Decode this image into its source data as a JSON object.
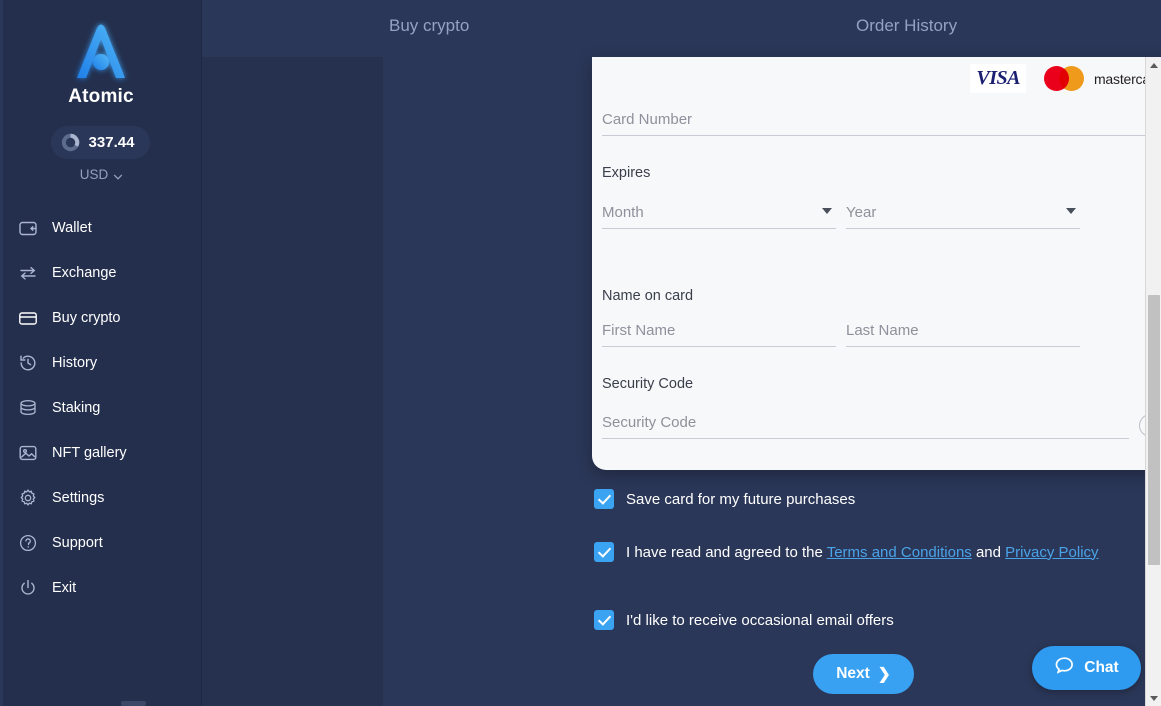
{
  "brand": {
    "name": "Atomic",
    "logo_icon": "atomic-logo-icon",
    "balance": "337.44",
    "balance_icon": "ring-chart-icon",
    "currency": "USD",
    "currency_chevron_icon": "chevron-down-icon"
  },
  "sidebar": {
    "items": [
      {
        "label": "Wallet",
        "icon": "wallet-icon",
        "active": false
      },
      {
        "label": "Exchange",
        "icon": "exchange-icon",
        "active": false
      },
      {
        "label": "Buy crypto",
        "icon": "credit-card-icon",
        "active": true
      },
      {
        "label": "History",
        "icon": "clock-history-icon",
        "active": false
      },
      {
        "label": "Staking",
        "icon": "database-icon",
        "active": false
      },
      {
        "label": "NFT gallery",
        "icon": "image-icon",
        "active": false
      },
      {
        "label": "Settings",
        "icon": "gear-icon",
        "active": false
      },
      {
        "label": "Support",
        "icon": "question-circle-icon",
        "active": false
      },
      {
        "label": "Exit",
        "icon": "power-icon",
        "active": false
      }
    ]
  },
  "header": {
    "tabs": [
      {
        "label": "Buy crypto"
      },
      {
        "label": "Order History"
      }
    ]
  },
  "payment_form": {
    "card_brands": [
      {
        "name": "visa-logo",
        "text": "VISA"
      },
      {
        "name": "mastercard-logo",
        "text": "mastercard"
      }
    ],
    "card_number": {
      "placeholder": "Card Number",
      "value": ""
    },
    "expires_label": "Expires",
    "month": {
      "placeholder": "Month",
      "value": ""
    },
    "year": {
      "placeholder": "Year",
      "value": ""
    },
    "name_on_card_label": "Name on card",
    "first_name": {
      "placeholder": "First Name",
      "value": ""
    },
    "last_name": {
      "placeholder": "Last Name",
      "value": ""
    },
    "security_code_label": "Security Code",
    "security_code": {
      "placeholder": "Security Code",
      "value": ""
    },
    "help_glyph": "?"
  },
  "consents": {
    "save_card": {
      "label": "Save card for my future purchases",
      "checked": true
    },
    "terms": {
      "prefix": "I have read and agreed to the ",
      "link1": "Terms and Conditions",
      "middle": " and ",
      "link2": "Privacy Policy",
      "checked": true
    },
    "email_offers": {
      "label": "I'd like to receive occasional email offers",
      "checked": true
    }
  },
  "actions": {
    "next_label": "Next",
    "next_arrow": "❯",
    "chat_label": "Chat",
    "chat_icon": "speech-bubble-icon"
  },
  "colors": {
    "sidebar_bg": "#242f4d",
    "header_bg": "#2b3758",
    "accent_blue": "#2e9bf0",
    "card_bg": "#f7f8fa",
    "link_blue": "#4aa3e8",
    "visa_blue": "#1a1f71",
    "mc_red": "#eb001b",
    "mc_yellow": "#f79e1b"
  }
}
